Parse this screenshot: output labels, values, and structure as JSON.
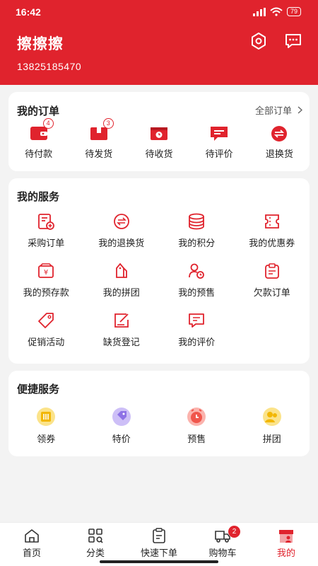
{
  "status": {
    "time": "16:42",
    "battery": "79"
  },
  "user": {
    "name": "擦擦擦",
    "phone": "13825185470"
  },
  "orders": {
    "title": "我的订单",
    "all_label": "全部订单",
    "items": [
      {
        "label": "待付款",
        "badge": "4",
        "icon": "wallet-icon"
      },
      {
        "label": "待发货",
        "badge": "3",
        "icon": "box-icon"
      },
      {
        "label": "待收货",
        "badge": "",
        "icon": "delivery-icon"
      },
      {
        "label": "待评价",
        "badge": "",
        "icon": "comment-icon"
      },
      {
        "label": "退换货",
        "badge": "",
        "icon": "exchange-icon"
      }
    ]
  },
  "services": {
    "title": "我的服务",
    "items": [
      {
        "label": "采购订单",
        "icon": "purchase-order-icon"
      },
      {
        "label": "我的退换货",
        "icon": "return-icon"
      },
      {
        "label": "我的积分",
        "icon": "points-icon"
      },
      {
        "label": "我的优惠券",
        "icon": "coupon-icon"
      },
      {
        "label": "我的预存款",
        "icon": "deposit-icon"
      },
      {
        "label": "我的拼团",
        "icon": "group-buy-icon"
      },
      {
        "label": "我的预售",
        "icon": "presale-icon"
      },
      {
        "label": "欠款订单",
        "icon": "debt-order-icon"
      },
      {
        "label": "促销活动",
        "icon": "promotion-icon"
      },
      {
        "label": "缺货登记",
        "icon": "stockout-icon"
      },
      {
        "label": "我的评价",
        "icon": "review-icon"
      }
    ]
  },
  "quick": {
    "title": "便捷服务",
    "items": [
      {
        "label": "领券",
        "icon": "coupon-claim-icon",
        "color": "#f5c542"
      },
      {
        "label": "特价",
        "icon": "special-price-icon",
        "color": "#8e72e6"
      },
      {
        "label": "预售",
        "icon": "presale-clock-icon",
        "color": "#f0564c"
      },
      {
        "label": "拼团",
        "icon": "group-icon",
        "color": "#f5c542"
      }
    ]
  },
  "tabs": [
    {
      "label": "首页",
      "icon": "home-icon"
    },
    {
      "label": "分类",
      "icon": "category-icon"
    },
    {
      "label": "快速下单",
      "icon": "quick-order-icon"
    },
    {
      "label": "购物车",
      "icon": "cart-icon",
      "badge": "2"
    },
    {
      "label": "我的",
      "icon": "profile-icon"
    }
  ],
  "colors": {
    "accent": "#e0232d"
  }
}
